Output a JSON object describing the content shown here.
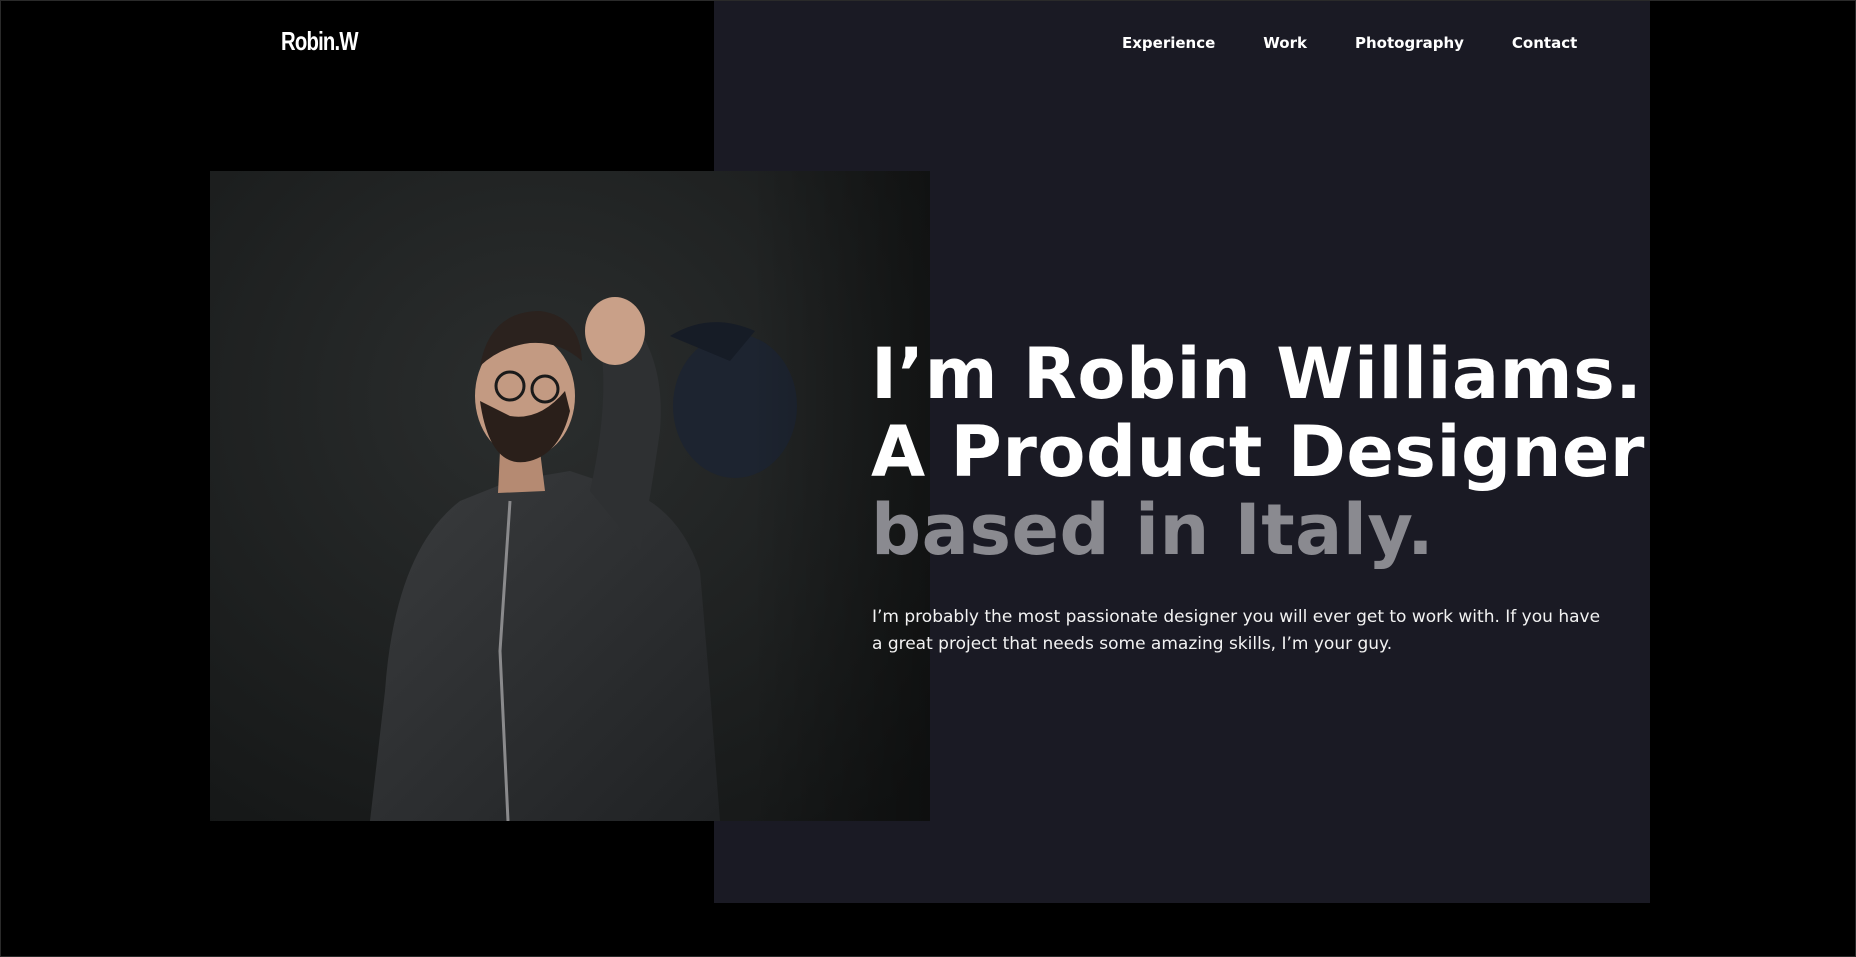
{
  "brand": {
    "logo": "Robin.W"
  },
  "nav": {
    "items": [
      {
        "label": "Experience"
      },
      {
        "label": "Work"
      },
      {
        "label": "Photography"
      },
      {
        "label": "Contact"
      }
    ]
  },
  "hero": {
    "line1": "I’m Robin Williams.",
    "line2": "A Product Designer",
    "line3": "based in Italy."
  },
  "intro": {
    "text": "I’m probably the most passionate designer you will ever get to work with. If you have a great project that needs some amazing skills, I’m your guy."
  },
  "colors": {
    "background": "#000000",
    "panel": "#1a1a24",
    "text_primary": "#ffffff",
    "text_muted": "#8a8a90"
  }
}
